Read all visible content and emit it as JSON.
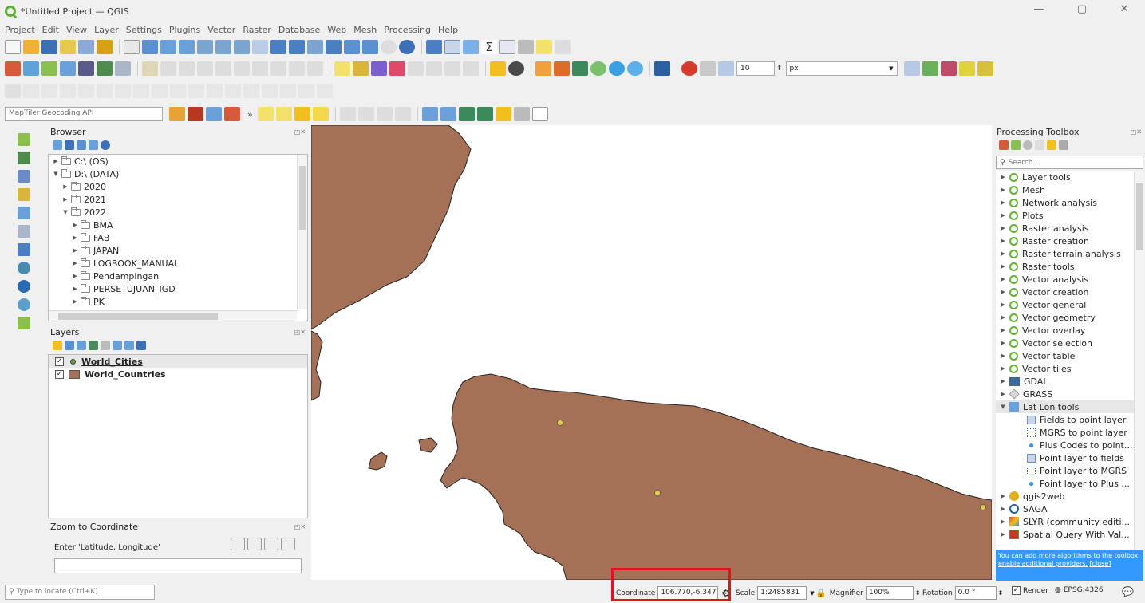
{
  "window": {
    "title": "*Untitled Project — QGIS"
  },
  "menu": [
    "Project",
    "Edit",
    "View",
    "Layer",
    "Settings",
    "Plugins",
    "Vector",
    "Raster",
    "Database",
    "Web",
    "Mesh",
    "Processing",
    "Help"
  ],
  "toolbar": {
    "geocoding_placeholder": "MapTiler Geocoding API",
    "snap_tolerance": "10",
    "snap_unit": "px"
  },
  "browser": {
    "title": "Browser",
    "items": [
      {
        "label": "C:\\ (OS)",
        "level": 0,
        "expanded": false
      },
      {
        "label": "D:\\ (DATA)",
        "level": 0,
        "expanded": true
      },
      {
        "label": "2020",
        "level": 1,
        "expanded": false
      },
      {
        "label": "2021",
        "level": 1,
        "expanded": false
      },
      {
        "label": "2022",
        "level": 1,
        "expanded": true
      },
      {
        "label": "BMA",
        "level": 2,
        "expanded": false
      },
      {
        "label": "FAB",
        "level": 2,
        "expanded": false
      },
      {
        "label": "JAPAN",
        "level": 2,
        "expanded": false
      },
      {
        "label": "LOGBOOK_MANUAL",
        "level": 2,
        "expanded": false
      },
      {
        "label": "Pendampingan",
        "level": 2,
        "expanded": false
      },
      {
        "label": "PERSETUJUAN_IGD",
        "level": 2,
        "expanded": false
      },
      {
        "label": "PK",
        "level": 2,
        "expanded": false
      }
    ]
  },
  "layers": {
    "title": "Layers",
    "items": [
      {
        "label": "World_Cities",
        "checked": true,
        "symbol": "point",
        "color": "#6a9e3b"
      },
      {
        "label": "World_Countries",
        "checked": true,
        "symbol": "fill",
        "color": "#a47156"
      }
    ]
  },
  "zoom": {
    "title": "Zoom to Coordinate",
    "prompt": "Enter 'Latitude, Longitude'",
    "value": ""
  },
  "processing": {
    "title": "Processing Toolbox",
    "search_placeholder": "Search...",
    "items": [
      {
        "label": "Layer tools",
        "icon": "qgis"
      },
      {
        "label": "Mesh",
        "icon": "qgis"
      },
      {
        "label": "Network analysis",
        "icon": "qgis"
      },
      {
        "label": "Plots",
        "icon": "qgis"
      },
      {
        "label": "Raster analysis",
        "icon": "qgis"
      },
      {
        "label": "Raster creation",
        "icon": "qgis"
      },
      {
        "label": "Raster terrain analysis",
        "icon": "qgis"
      },
      {
        "label": "Raster tools",
        "icon": "qgis"
      },
      {
        "label": "Vector analysis",
        "icon": "qgis"
      },
      {
        "label": "Vector creation",
        "icon": "qgis"
      },
      {
        "label": "Vector general",
        "icon": "qgis"
      },
      {
        "label": "Vector geometry",
        "icon": "qgis"
      },
      {
        "label": "Vector overlay",
        "icon": "qgis"
      },
      {
        "label": "Vector selection",
        "icon": "qgis"
      },
      {
        "label": "Vector table",
        "icon": "qgis"
      },
      {
        "label": "Vector tiles",
        "icon": "qgis"
      },
      {
        "label": "GDAL",
        "icon": "gdal"
      },
      {
        "label": "GRASS",
        "icon": "grass"
      },
      {
        "label": "Lat Lon tools",
        "icon": "latlon",
        "expanded": true
      },
      {
        "label": "Fields to point layer",
        "icon": "table",
        "child": true
      },
      {
        "label": "MGRS to point layer",
        "icon": "grid",
        "child": true
      },
      {
        "label": "Plus Codes to point...",
        "icon": "dots",
        "child": true
      },
      {
        "label": "Point layer to fields",
        "icon": "table",
        "child": true
      },
      {
        "label": "Point layer to MGRS",
        "icon": "grid",
        "child": true
      },
      {
        "label": "Point layer to Plus ...",
        "icon": "dots",
        "child": true
      },
      {
        "label": "qgis2web",
        "icon": "gear"
      },
      {
        "label": "SAGA",
        "icon": "saga"
      },
      {
        "label": "SLYR (community editi...",
        "icon": "slyr"
      },
      {
        "label": "Spatial Query With Val...",
        "icon": "spatial"
      }
    ],
    "note_text": "You can add more algorithms to the toolbox,",
    "note_link": "enable additional providers.",
    "note_close": "[close]"
  },
  "statusbar": {
    "locator_placeholder": "Type to locate (Ctrl+K)",
    "coordinate_label": "Coordinate",
    "coordinate_value": "106.770,-6.347",
    "scale_label": "Scale",
    "scale_value": "1:2485831",
    "magnifier_label": "Magnifier",
    "magnifier_value": "100%",
    "rotation_label": "Rotation",
    "rotation_value": "0.0 °",
    "render_label": "Render",
    "crs_label": "EPSG:4326"
  },
  "colors": {
    "land": "#a47156",
    "sea": "#ffffff",
    "city": "#e6c84a",
    "accent": "#3399ff",
    "highlight": "#e0141e"
  }
}
